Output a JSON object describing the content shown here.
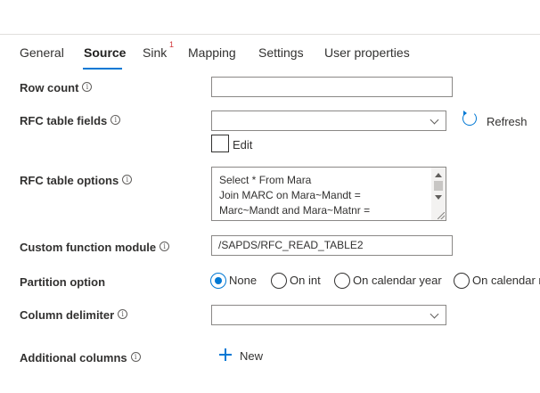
{
  "tabs": [
    {
      "label": "General"
    },
    {
      "label": "Source"
    },
    {
      "label": "Sink"
    },
    {
      "label": "Mapping"
    },
    {
      "label": "Settings"
    },
    {
      "label": "User properties"
    }
  ],
  "active_tab": "Source",
  "sink_badge": "1",
  "colors": {
    "accent": "#0078d4",
    "badge": "#d13438",
    "text": "#323130",
    "border": "#8a8886"
  },
  "form": {
    "row_count": {
      "label": "Row count",
      "value": ""
    },
    "rfc_table_fields": {
      "label": "RFC table fields",
      "value": ""
    },
    "refresh_label": "Refresh",
    "edit": {
      "label": "Edit",
      "checked": false
    },
    "rfc_table_options": {
      "label": "RFC table options",
      "lines": [
        "Select * From Mara",
        "Join MARC on Mara~Mandt =",
        "Marc~Mandt and Mara~Matnr ="
      ]
    },
    "custom_function_module": {
      "label": "Custom function module",
      "value": "/SAPDS/RFC_READ_TABLE2"
    },
    "partition_option": {
      "label": "Partition option",
      "options": [
        "None",
        "On int",
        "On calendar year",
        "On calendar m"
      ],
      "selected": "None"
    },
    "column_delimiter": {
      "label": "Column delimiter",
      "value": ""
    },
    "additional_columns": {
      "label": "Additional columns",
      "new_label": "New"
    }
  },
  "icons": {
    "info": "info-icon",
    "refresh": "refresh-icon",
    "chevron": "chevron-down-icon",
    "plus": "plus-icon"
  }
}
